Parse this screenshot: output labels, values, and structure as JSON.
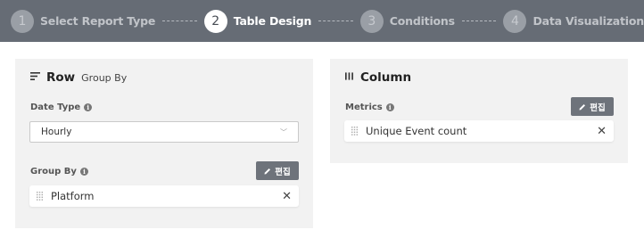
{
  "stepper": {
    "steps": [
      {
        "number": "1",
        "label": "Select Report Type"
      },
      {
        "number": "2",
        "label": "Table Design"
      },
      {
        "number": "3",
        "label": "Conditions"
      },
      {
        "number": "4",
        "label": "Data Visualization"
      }
    ],
    "active_step": "2"
  },
  "row_panel": {
    "title": "Row",
    "subtitle": "Group By",
    "date_type_label": "Date Type",
    "date_type_value": "Hourly",
    "group_by_label": "Group By",
    "edit_label": "편집",
    "group_by_items": [
      "Platform"
    ]
  },
  "column_panel": {
    "title": "Column",
    "metrics_label": "Metrics",
    "edit_label": "편집",
    "metrics_items": [
      "Unique Event count"
    ]
  },
  "icons": {
    "row": "rows-icon",
    "column": "columns-icon",
    "info": "info-icon",
    "edit": "pencil-icon",
    "drag": "drag-handle-icon",
    "close": "close-icon",
    "dropdown": "chevron-down-icon"
  },
  "colors": {
    "stepper_bg": "#666c75",
    "panel_bg": "#f2f2f2",
    "button_bg": "#6e737b"
  }
}
